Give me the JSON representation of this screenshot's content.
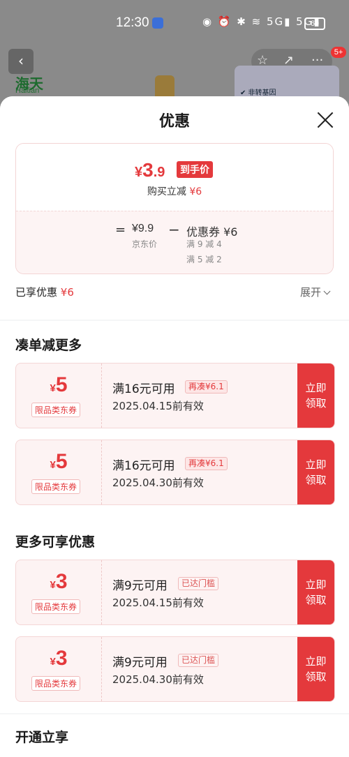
{
  "status_bar": {
    "time": "12:30",
    "icons": "◉ ⏰ ✱ ≋ 5G▮ 5G▮",
    "battery": "69"
  },
  "background": {
    "back_icon": "‹",
    "actions": [
      "☆",
      "↗",
      "···"
    ],
    "badge": "5+",
    "brand_cn": "海天",
    "brand_en": "Haitian",
    "thumb_text": "✔ 非转基因"
  },
  "sheet": {
    "title": "优惠",
    "price": {
      "yen": "¥",
      "int": "3",
      "dec": ".9",
      "tag": "到手价",
      "sub_prefix": "购买立减",
      "sub_value": "¥6"
    },
    "calc": {
      "eq": "=",
      "jd_price": "¥9.9",
      "jd_label": "京东价",
      "minus": "−",
      "coupon": "优惠券 ¥6",
      "rule1": "满 9 减 4",
      "rule2": "满 5 减 2"
    },
    "saved": {
      "label": "已享优惠",
      "value": "¥6"
    },
    "expand": "展开"
  },
  "sections": [
    {
      "title": "凑单减更多",
      "coupons": [
        {
          "yen": "¥",
          "amount": "5",
          "tag": "限品类东券",
          "cond": "满16元可用",
          "badge": "再凑¥6.1",
          "date": "2025.04.15前有效",
          "btn1": "立即",
          "btn2": "领取"
        },
        {
          "yen": "¥",
          "amount": "5",
          "tag": "限品类东券",
          "cond": "满16元可用",
          "badge": "再凑¥6.1",
          "date": "2025.04.30前有效",
          "btn1": "立即",
          "btn2": "领取"
        }
      ]
    },
    {
      "title": "更多可享优惠",
      "coupons": [
        {
          "yen": "¥",
          "amount": "3",
          "tag": "限品类东券",
          "cond": "满9元可用",
          "badge": "已达门槛",
          "date": "2025.04.15前有效",
          "btn1": "立即",
          "btn2": "领取"
        },
        {
          "yen": "¥",
          "amount": "3",
          "tag": "限品类东券",
          "cond": "满9元可用",
          "badge": "已达门槛",
          "date": "2025.04.30前有效",
          "btn1": "立即",
          "btn2": "领取"
        }
      ]
    },
    {
      "title": "开通立享",
      "coupons": []
    }
  ]
}
